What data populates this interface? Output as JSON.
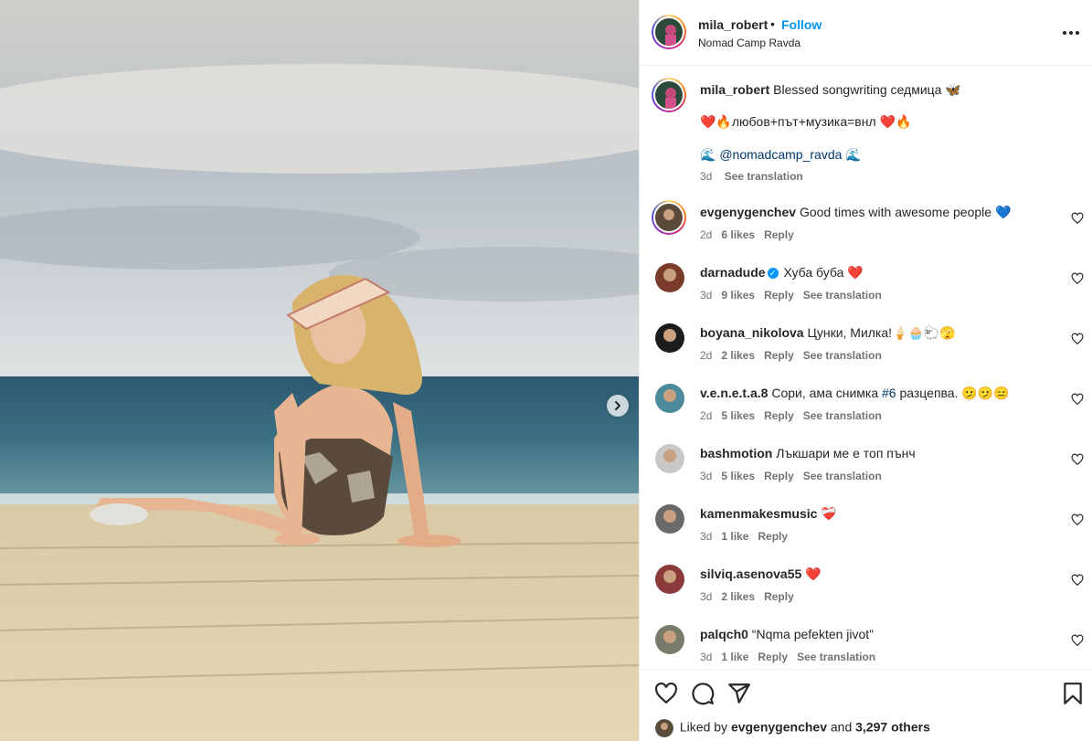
{
  "post": {
    "username": "mila_robert",
    "dot": "•",
    "follow_label": "Follow",
    "location": "Nomad Camp Ravda",
    "caption": {
      "username": "mila_robert",
      "line1": "Blessed songwriting седмица 🦋",
      "line2": "❤️🔥любов+път+музика=внл ❤️🔥",
      "line3_prefix": "🌊 ",
      "mention": "@nomadcamp_ravda",
      "line3_suffix": " 🌊",
      "time": "3d",
      "see_translation": "See translation"
    }
  },
  "comments": [
    {
      "username": "evgenygenchev",
      "text": "Good times with awesome people 💙",
      "time": "2d",
      "likes": "6 likes",
      "reply": "Reply",
      "translation": "",
      "verified": false,
      "avatar_color": "#5a4a3a"
    },
    {
      "username": "darnadude",
      "text": "Хуба буба ❤️",
      "time": "3d",
      "likes": "9 likes",
      "reply": "Reply",
      "translation": "See translation",
      "verified": true,
      "avatar_color": "#7a3b2a"
    },
    {
      "username": "boyana_nikolova",
      "text": "Цунки, Милка!🍦🧁🐑🫣",
      "time": "2d",
      "likes": "2 likes",
      "reply": "Reply",
      "translation": "See translation",
      "verified": false,
      "avatar_color": "#1c1c1c"
    },
    {
      "username": "v.e.n.e.t.a.8",
      "text": "Сори, ама снимка",
      "hashtag": "#6",
      "text_after": "разцепва. 🫤🫤😑",
      "time": "2d",
      "likes": "5 likes",
      "reply": "Reply",
      "translation": "See translation",
      "verified": false,
      "avatar_color": "#4a8a9a"
    },
    {
      "username": "bashmotion",
      "text": "Лъкшари ме е топ пънч",
      "time": "3d",
      "likes": "5 likes",
      "reply": "Reply",
      "translation": "See translation",
      "verified": false,
      "avatar_color": "#c8c8c8"
    },
    {
      "username": "kamenmakesmusic",
      "text": "❤️‍🩹",
      "time": "3d",
      "likes": "1 like",
      "reply": "Reply",
      "translation": "",
      "verified": false,
      "avatar_color": "#6a6a6a"
    },
    {
      "username": "silviq.asenova55",
      "text": "❤️",
      "time": "3d",
      "likes": "2 likes",
      "reply": "Reply",
      "translation": "",
      "verified": false,
      "avatar_color": "#8a3a3a"
    },
    {
      "username": "palqch0",
      "text": "“Nqma pefekten jivot”",
      "time": "3d",
      "likes": "1 like",
      "reply": "Reply",
      "translation": "See translation",
      "verified": false,
      "avatar_color": "#7a7a6a"
    }
  ],
  "likes_bar": {
    "prefix": "Liked by",
    "user": "evgenygenchev",
    "and": "and",
    "others": "3,297 others"
  },
  "colors": {
    "accent": "#0095f6",
    "text": "#262626",
    "muted": "#737373",
    "heart": "#e0245e"
  }
}
